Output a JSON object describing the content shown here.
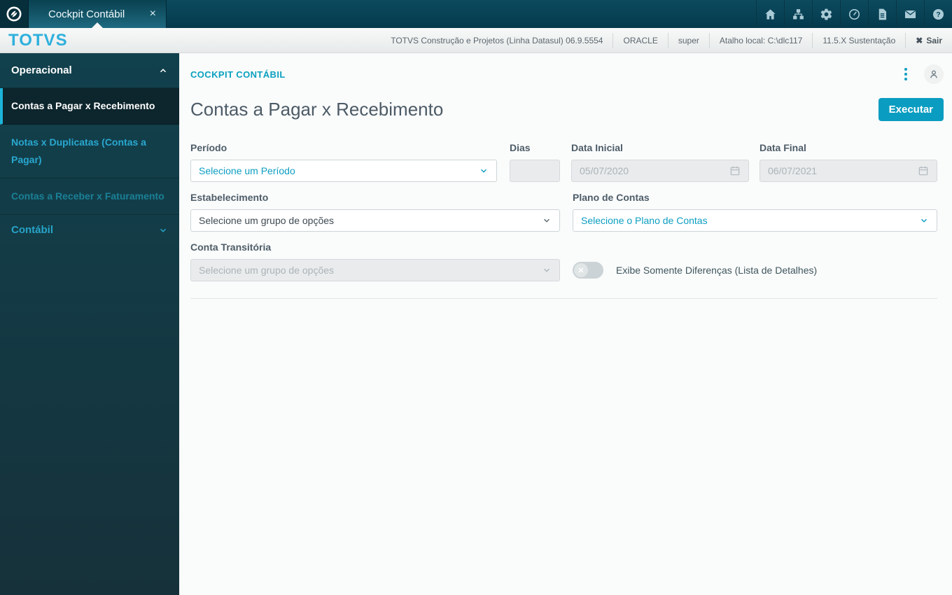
{
  "colors": {
    "accent": "#0c9ec2",
    "topbar": "#07445a",
    "sidebar": "#16323a",
    "brand_logo": "#2fb0dc"
  },
  "topbar": {
    "tab_title": "Cockpit Contábil",
    "tab_close": "×",
    "icons": [
      "home",
      "sitemap",
      "gear",
      "clock",
      "document",
      "mail",
      "help"
    ]
  },
  "infobar": {
    "brand": "TOTVS",
    "items": [
      "TOTVS Construção e Projetos (Linha Datasul) 06.9.5554",
      "ORACLE",
      "super",
      "Atalho local: C:\\dlc117",
      "11.5.X Sustentação"
    ],
    "sair_label": "Sair",
    "sair_icon": "✖"
  },
  "sidebar": {
    "section_label": "Operacional",
    "items": [
      {
        "label": "Contas a Pagar x Recebimento",
        "active": true
      },
      {
        "label": "Notas x Duplicatas (Contas a Pagar)",
        "active": false
      },
      {
        "label": "Contas a Receber x Faturamento",
        "active": false
      }
    ],
    "collapsed_section_label": "Contábil"
  },
  "main": {
    "breadcrumb": "COCKPIT CONTÁBIL",
    "title": "Contas a Pagar x Recebimento",
    "execute_label": "Executar",
    "form": {
      "periodo": {
        "label": "Período",
        "value": "Selecione um Período"
      },
      "dias": {
        "label": "Dias",
        "value": ""
      },
      "data_inicial": {
        "label": "Data Inicial",
        "value": "05/07/2020"
      },
      "data_final": {
        "label": "Data Final",
        "value": "06/07/2021"
      },
      "estabelecimento": {
        "label": "Estabelecimento",
        "value": "Selecione um grupo de opções"
      },
      "plano_contas": {
        "label": "Plano de Contas",
        "value": "Selecione o Plano de Contas"
      },
      "conta_transitoria": {
        "label": "Conta Transitória",
        "value": "Selecione um grupo de opções"
      },
      "toggle": {
        "label": "Exibe Somente Diferenças (Lista de Detalhes)",
        "state": "off",
        "knob_glyph": "✕"
      }
    }
  }
}
